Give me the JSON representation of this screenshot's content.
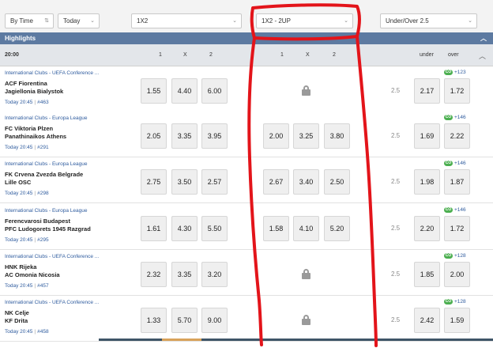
{
  "filters": {
    "sort_label": "By Time",
    "day_label": "Today",
    "market1_label": "1X2",
    "market2_label": "1X2 - 2UP",
    "market3_label": "Under/Over 2.5"
  },
  "highlights": {
    "title": "Highlights"
  },
  "columns": {
    "time": "20:00",
    "m1": [
      "1",
      "X",
      "2"
    ],
    "m2": [
      "1",
      "X",
      "2"
    ],
    "under": "under",
    "over": "over"
  },
  "matches": [
    {
      "league": "International Clubs - UEFA Conference ...",
      "home": "ACF Fiorentina",
      "away": "Jagiellonia Bialystok",
      "time": "Today 20:45",
      "code": "#463",
      "m1": [
        "1.55",
        "4.40",
        "6.00"
      ],
      "m2": null,
      "line": "2.5",
      "ou": [
        "2.17",
        "1.72"
      ],
      "more": "+123"
    },
    {
      "league": "International Clubs - Europa League",
      "home": "FC Viktoria Plzen",
      "away": "Panathinaikos Athens",
      "time": "Today 20:45",
      "code": "#291",
      "m1": [
        "2.05",
        "3.35",
        "3.95"
      ],
      "m2": [
        "2.00",
        "3.25",
        "3.80"
      ],
      "line": "2.5",
      "ou": [
        "1.69",
        "2.22"
      ],
      "more": "+146"
    },
    {
      "league": "International Clubs - Europa League",
      "home": "FK Crvena Zvezda Belgrade",
      "away": "Lille OSC",
      "time": "Today 20:45",
      "code": "#298",
      "m1": [
        "2.75",
        "3.50",
        "2.57"
      ],
      "m2": [
        "2.67",
        "3.40",
        "2.50"
      ],
      "line": "2.5",
      "ou": [
        "1.98",
        "1.87"
      ],
      "more": "+146"
    },
    {
      "league": "International Clubs - Europa League",
      "home": "Ferencvarosi Budapest",
      "away": "PFC Ludogorets 1945 Razgrad",
      "time": "Today 20:45",
      "code": "#295",
      "m1": [
        "1.61",
        "4.30",
        "5.50"
      ],
      "m2": [
        "1.58",
        "4.10",
        "5.20"
      ],
      "line": "2.5",
      "ou": [
        "2.20",
        "1.72"
      ],
      "more": "+146"
    },
    {
      "league": "International Clubs - UEFA Conference ...",
      "home": "HNK Rijeka",
      "away": "AC Omonia Nicosia",
      "time": "Today 20:45",
      "code": "#457",
      "m1": [
        "2.32",
        "3.35",
        "3.20"
      ],
      "m2": null,
      "line": "2.5",
      "ou": [
        "1.85",
        "2.00"
      ],
      "more": "+128"
    },
    {
      "league": "International Clubs - UEFA Conference ...",
      "home": "NK Celje",
      "away": "KF Drita",
      "time": "Today 20:45",
      "code": "#458",
      "m1": [
        "1.33",
        "5.70",
        "9.00"
      ],
      "m2": null,
      "line": "2.5",
      "ou": [
        "2.42",
        "1.59"
      ],
      "more": "+128"
    }
  ],
  "icons": {
    "sort": "sort-arrows-icon",
    "chevron": "chevron-down-icon",
    "collapse": "chevron-up-icon",
    "lock": "lock-icon",
    "cashout": "cashout-badge-icon"
  },
  "colors": {
    "header_bar": "#5d7aa1",
    "column_header": "#e3e6ea",
    "odd_button": "#efefef",
    "link_blue": "#2e5b9e",
    "cashout_green": "#4caf50",
    "annotation_red": "#e3141a"
  },
  "cashout_badge": "CO"
}
